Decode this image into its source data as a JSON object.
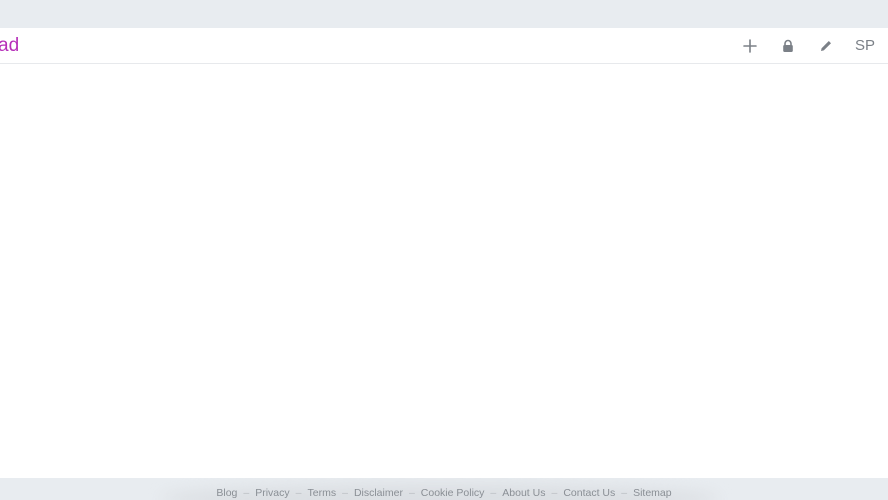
{
  "header": {
    "brand_text": "ad",
    "brand_color": "#b62fb9",
    "actions": [
      {
        "icon": "plus-icon"
      },
      {
        "icon": "lock-icon"
      },
      {
        "icon": "pencil-icon"
      }
    ],
    "avatar_initials": "SP"
  },
  "footer": {
    "links": [
      "Blog",
      "Privacy",
      "Terms",
      "Disclaimer",
      "Cookie Policy",
      "About Us",
      "Contact Us",
      "Sitemap"
    ],
    "separator": "–"
  },
  "colors": {
    "background": "#ffffff",
    "strip": "#e8ecf0",
    "icon": "#7b8087"
  }
}
